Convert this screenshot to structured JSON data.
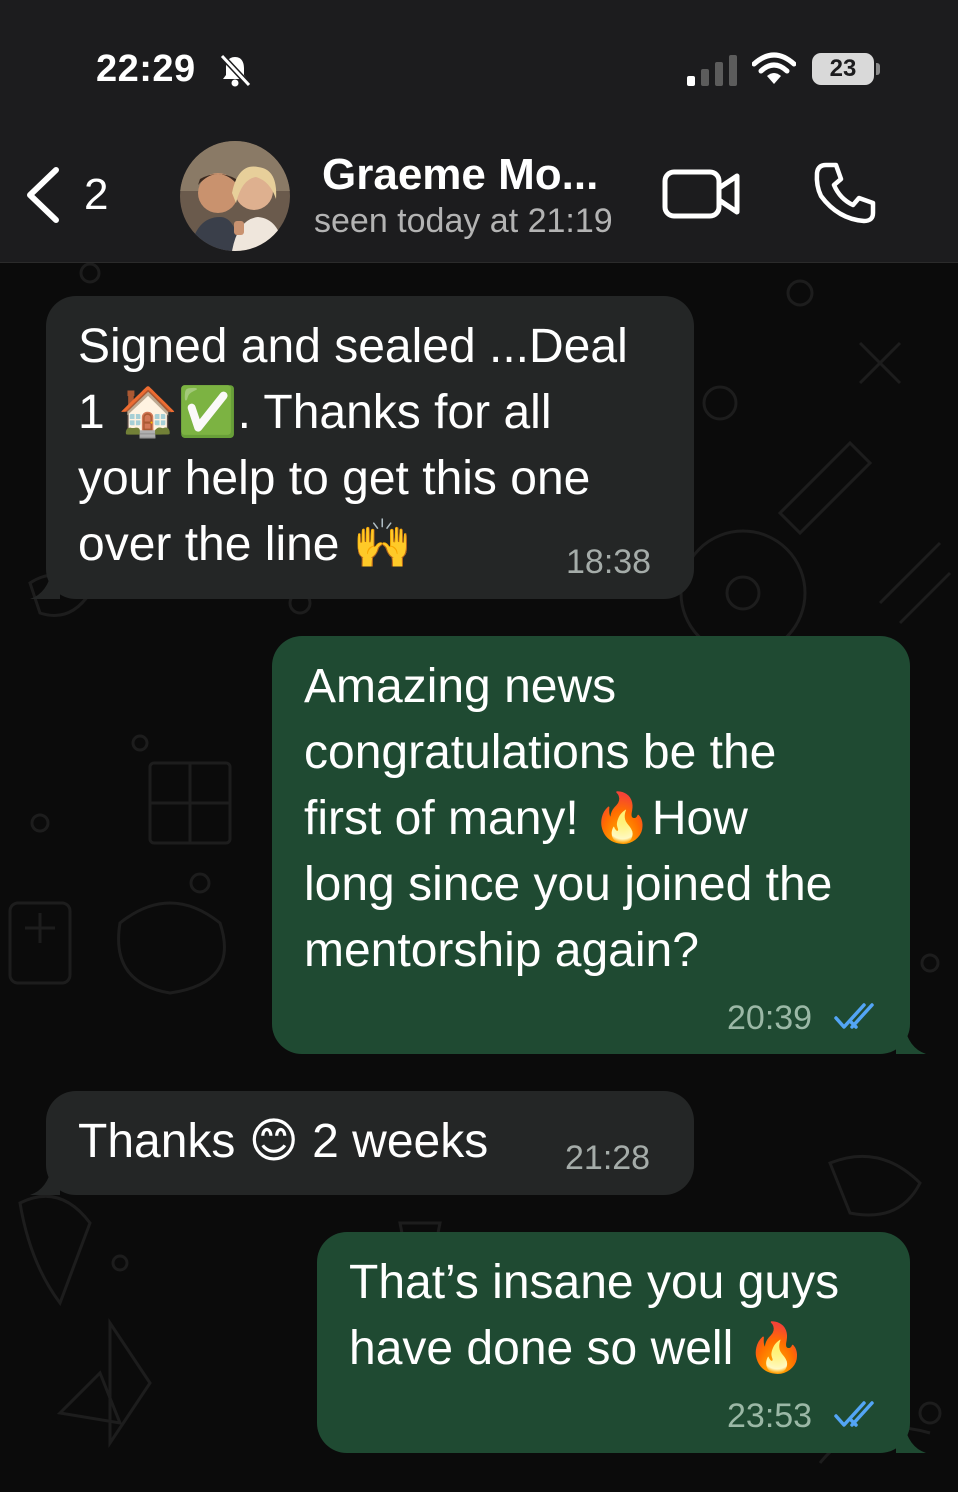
{
  "status_bar": {
    "time": "22:29",
    "battery": "23",
    "icons": [
      "bell-slash-icon",
      "signal-icon",
      "wifi-icon",
      "battery-icon"
    ]
  },
  "header": {
    "back_count": "2",
    "contact_name": "Graeme Mo...",
    "last_seen": "seen today at 21:19",
    "icons": [
      "back-chevron-icon",
      "video-call-icon",
      "phone-icon"
    ]
  },
  "messages": [
    {
      "direction": "incoming",
      "text": "Signed and sealed ...Deal\n1 🏠✅. Thanks for all\nyour help to get this one\nover the line 🙌",
      "time": "18:38"
    },
    {
      "direction": "outgoing",
      "text": "Amazing news\ncongratulations be the\nfirst of many! 🔥How\nlong since you joined the\nmentorship again?",
      "time": "20:39",
      "status": "read"
    },
    {
      "direction": "incoming",
      "text": "Thanks 😊 2 weeks",
      "time": "21:28"
    },
    {
      "direction": "outgoing",
      "text": "That’s insane you guys\nhave done so well 🔥",
      "time": "23:53",
      "status": "read"
    }
  ],
  "colors": {
    "bar_bg": "#1c1c1e",
    "chat_bg": "#0b0b0b",
    "incoming_bubble": "#242626",
    "outgoing_bubble": "#1f4a32",
    "read_ticks": "#53a5f5"
  }
}
